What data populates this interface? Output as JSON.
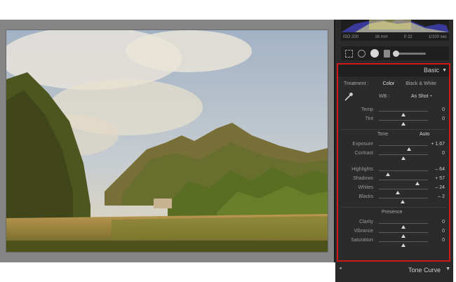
{
  "histogram": {
    "iso": "ISO 200",
    "focal": "16 mm",
    "aperture": "f/ 22",
    "shutter": "1/100 sec"
  },
  "tools": [
    "crop-icon",
    "spot-removal-icon",
    "red-eye-icon",
    "graduated-filter-icon",
    "adjustment-brush-icon"
  ],
  "basic": {
    "title": "Basic",
    "treatment_label": "Treatment :",
    "treatment_color": "Color",
    "treatment_bw": "Black & White",
    "wb_label": "WB :",
    "wb_value": "As Shot ÷",
    "temp": {
      "label": "Temp",
      "value": "0",
      "pos": 0.5
    },
    "tint": {
      "label": "Tint",
      "value": "0",
      "pos": 0.5
    },
    "tone_label": "Tone",
    "auto_label": "Auto",
    "exposure": {
      "label": "Exposure",
      "value": "+ 1.67",
      "pos": 0.62
    },
    "contrast": {
      "label": "Contrast",
      "value": "0",
      "pos": 0.5
    },
    "highlights": {
      "label": "Highlights",
      "value": "– 64",
      "pos": 0.18
    },
    "shadows": {
      "label": "Shadows",
      "value": "+ 57",
      "pos": 0.78
    },
    "whites": {
      "label": "Whites",
      "value": "– 24",
      "pos": 0.38
    },
    "blacks": {
      "label": "Blacks",
      "value": "– 2",
      "pos": 0.49
    },
    "presence_label": "Presence",
    "clarity": {
      "label": "Clarity",
      "value": "0",
      "pos": 0.5
    },
    "vibrance": {
      "label": "Vibrance",
      "value": "0",
      "pos": 0.5
    },
    "saturation": {
      "label": "Saturation",
      "value": "0",
      "pos": 0.5
    }
  },
  "next_panel": {
    "title": "Tone Curve"
  },
  "colors": {
    "highlight_border": "#d01818",
    "panel_bg": "#2b2b2b"
  }
}
